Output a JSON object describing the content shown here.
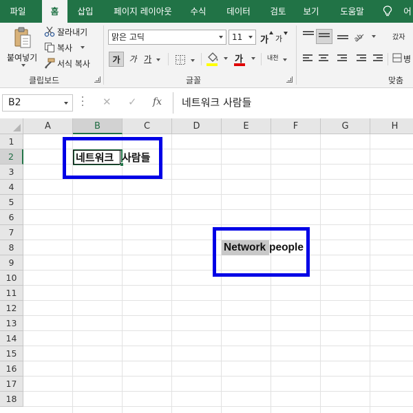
{
  "ribbon_tabs": [
    "파일",
    "홈",
    "삽입",
    "페이지 레이아웃",
    "수식",
    "데이터",
    "검토",
    "보기",
    "도움말",
    "어"
  ],
  "active_tab": "홈",
  "clipboard": {
    "paste_label": "붙여넣기",
    "cut_label": "잘라내기",
    "copy_label": "복사",
    "format_painter_label": "서식 복사",
    "group_label": "클립보드"
  },
  "font": {
    "font_name": "맑은 고딕",
    "font_size": "11",
    "grow_label": "가",
    "shrink_label": "가",
    "bold_label": "가",
    "italic_label": "가",
    "underline_label": "가",
    "font_color_label": "가",
    "phonetic_label": "내천",
    "group_label": "글꼴",
    "font_color": "#e00000",
    "fill_color": "#ffff00"
  },
  "alignment": {
    "wrap_label": "갔자",
    "merge_label": "병",
    "group_label": "맞춤"
  },
  "formula_bar": {
    "name_box": "B2",
    "fx_label": "fx",
    "content": "네트워크 사람들"
  },
  "columns": [
    "A",
    "B",
    "C",
    "D",
    "E",
    "F",
    "G",
    "H"
  ],
  "selected_column": "B",
  "rows": [
    "1",
    "2",
    "3",
    "4",
    "5",
    "6",
    "7",
    "8",
    "9",
    "10",
    "11",
    "12",
    "13",
    "14",
    "15",
    "16",
    "17",
    "18"
  ],
  "selected_row": "2",
  "cells": {
    "b2_word": "네트워크",
    "b2_rest": "사람들",
    "e8_word": "Network",
    "e8_rest": "people"
  },
  "colors": {
    "tab_bar": "#217346",
    "highlight_box": "#0000e6",
    "selection": "#217346"
  }
}
